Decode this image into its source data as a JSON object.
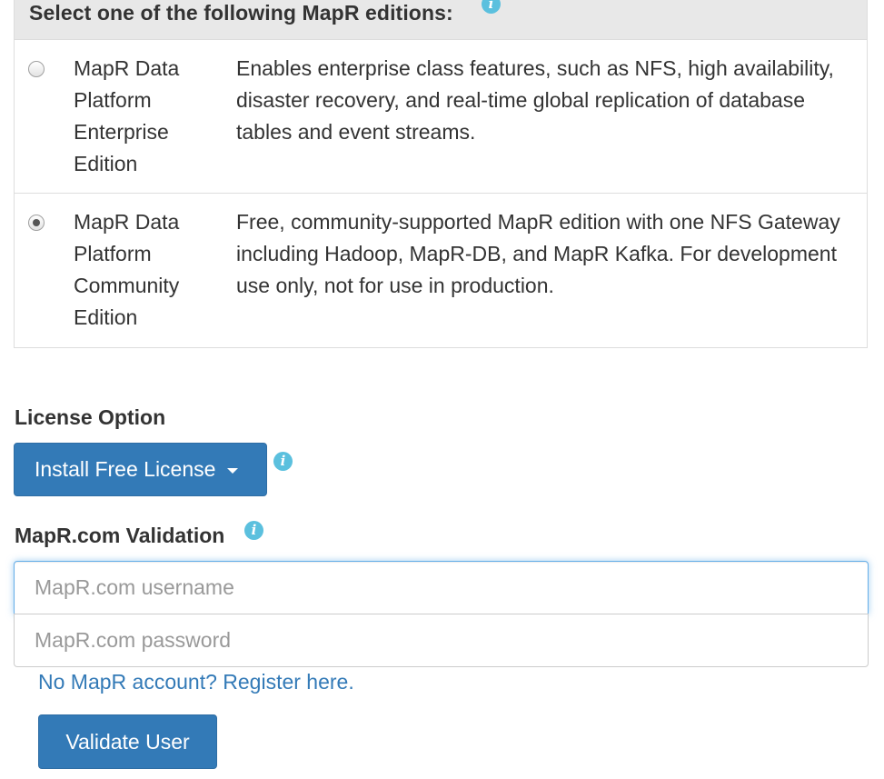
{
  "editions": {
    "header": "Select one of the following MapR editions:",
    "header_info_icon": "info-icon",
    "items": [
      {
        "name": "MapR Data Platform Enterprise Edition",
        "description": "Enables enterprise class features, such as NFS, high availability, disaster recovery, and real-time global replication of database tables and event streams.",
        "selected": false
      },
      {
        "name": "MapR Data Platform Community Edition",
        "description": "Free, community-supported MapR edition with one NFS Gateway including Hadoop, MapR-DB, and MapR Kafka. For development use only, not for use in production.",
        "selected": true
      }
    ]
  },
  "license": {
    "label": "License Option",
    "button_label": "Install Free License",
    "info_icon": "info-icon"
  },
  "validation": {
    "label": "MapR.com Validation",
    "info_icon": "info-icon",
    "username_placeholder": "MapR.com username",
    "username_value": "",
    "password_placeholder": "MapR.com password",
    "password_value": "",
    "register_link": "No MapR account? Register here.",
    "validate_button": "Validate User"
  },
  "colors": {
    "primary": "#337ab7",
    "info": "#5bc0de",
    "header_bg": "#e8e8e8",
    "focus_border": "#66afe9"
  }
}
